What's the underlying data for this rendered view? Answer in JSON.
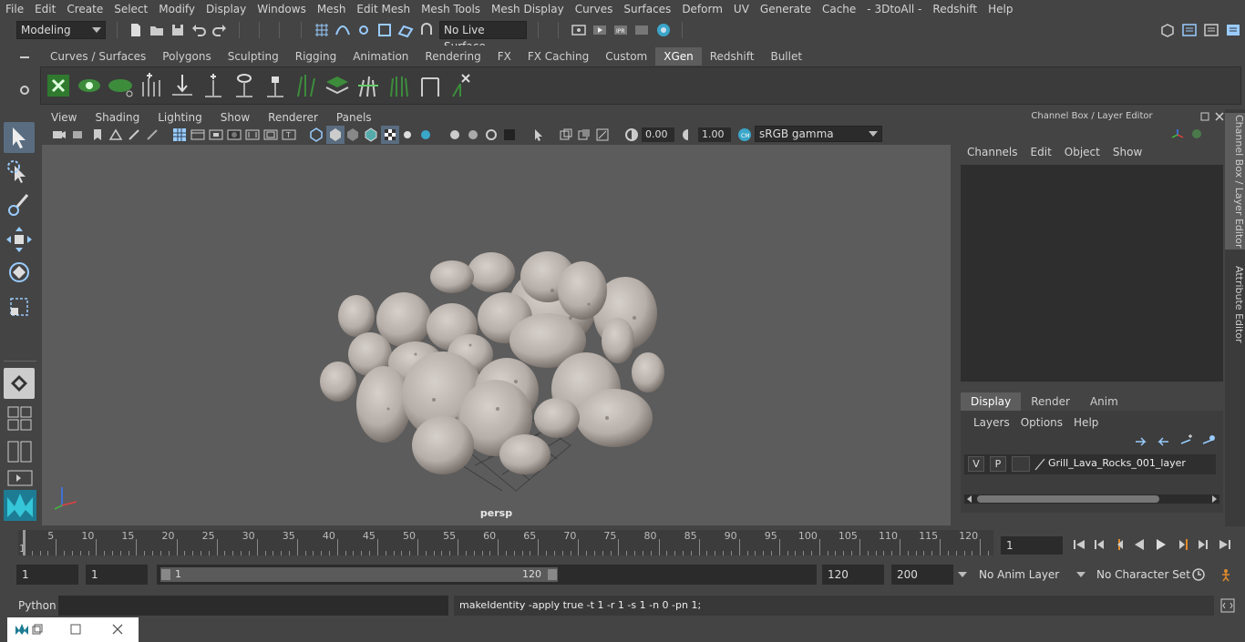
{
  "menubar": [
    "File",
    "Edit",
    "Create",
    "Select",
    "Modify",
    "Display",
    "Windows",
    "Mesh",
    "Edit Mesh",
    "Mesh Tools",
    "Mesh Display",
    "Curves",
    "Surfaces",
    "Deform",
    "UV",
    "Generate",
    "Cache",
    "- 3DtoAll -",
    "Redshift",
    "Help"
  ],
  "status": {
    "mode": "Modeling",
    "live_surface": "No Live Surface"
  },
  "shelf_tabs": [
    "Curves / Surfaces",
    "Polygons",
    "Sculpting",
    "Rigging",
    "Animation",
    "Rendering",
    "FX",
    "FX Caching",
    "Custom",
    "XGen",
    "Redshift",
    "Bullet"
  ],
  "shelf_active": "XGen",
  "viewport_menu": [
    "View",
    "Shading",
    "Lighting",
    "Show",
    "Renderer",
    "Panels"
  ],
  "viewport": {
    "exposure": "0.00",
    "gamma": "1.00",
    "colorspace": "sRGB gamma",
    "camera_label": "persp"
  },
  "right_panel": {
    "title": "Channel Box / Layer Editor",
    "menu": [
      "Channels",
      "Edit",
      "Object",
      "Show"
    ],
    "tabs": [
      "Display",
      "Render",
      "Anim"
    ],
    "active_tab": "Display",
    "submenu": [
      "Layers",
      "Options",
      "Help"
    ],
    "layer": {
      "v": "V",
      "p": "P",
      "name": "Grill_Lava_Rocks_001_layer"
    }
  },
  "side_tabs": [
    "Channel Box / Layer Editor",
    "Attribute Editor"
  ],
  "timeline": {
    "ticks": [
      5,
      10,
      15,
      20,
      25,
      30,
      35,
      40,
      45,
      50,
      55,
      60,
      65,
      70,
      75,
      80,
      85,
      90,
      95,
      100,
      105,
      110,
      115,
      120
    ],
    "start_label": "1",
    "current_frame": "1"
  },
  "range": {
    "start": "1",
    "playback_start": "1",
    "slider_start": "1",
    "slider_end": "120",
    "playback_end": "120",
    "end": "200",
    "anim_layer": "No Anim Layer",
    "char_set": "No Character Set"
  },
  "cmd": {
    "lang": "Python",
    "result": "makeIdentity -apply true -t 1 -r 1 -s 1 -n 0 -pn 1;"
  },
  "colors": {
    "accent": "#5a6d80",
    "bg": "#444444",
    "viewport": "#5c5c5c",
    "dark": "#2b2b2b"
  }
}
